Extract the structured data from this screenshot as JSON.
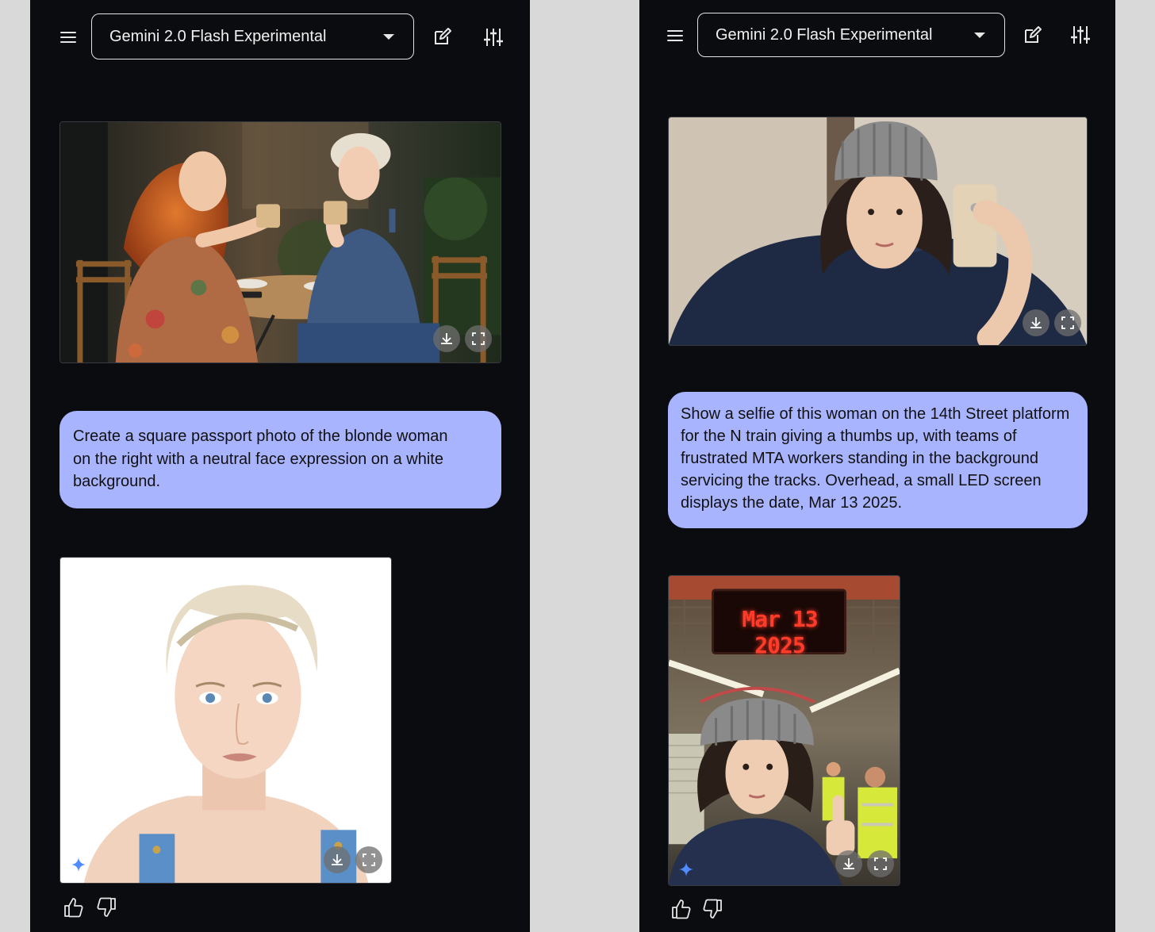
{
  "left_panel": {
    "model_name": "Gemini 2.0 Flash Experimental",
    "prompt": "Create a square passport photo of the blonde woman on the right with a neutral face expression on a white background.",
    "prompt_lines": [
      "Create a square passport photo of the blonde woman",
      "on the right with a neutral face expression on a white",
      "background."
    ]
  },
  "right_panel": {
    "model_name": "Gemini 2.0 Flash Experimental",
    "prompt": "Show a selfie of this woman on the 14th Street platform for the N train giving a thumbs up, with teams of frustrated MTA workers standing in the background servicing the tracks. Overhead, a small LED screen displays the date, Mar 13 2025.",
    "prompt_lines": [
      "Show a selfie of this woman on the 14th Street platform",
      "for the N train giving a thumbs up, with teams of",
      "frustrated MTA workers standing in the background",
      "servicing the tracks. Overhead, a small LED screen",
      "displays the date, Mar 13 2025."
    ],
    "led_display": "Mar 13 2025"
  },
  "icons": {
    "menu": "menu-icon",
    "caret": "chevron-down-icon",
    "edit": "edit-icon",
    "tune": "tune-icon",
    "download": "download-icon",
    "fullscreen": "fullscreen-icon",
    "sparkle": "gemini-sparkle-icon",
    "thumbs_up": "thumbs-up-icon",
    "thumbs_down": "thumbs-down-icon"
  },
  "colors": {
    "panel_bg": "#0b0c10",
    "page_bg": "#d9d9d9",
    "bubble_bg": "#a9b4ff",
    "sparkle": "#4f8cff",
    "led": "#ff3b2a"
  }
}
